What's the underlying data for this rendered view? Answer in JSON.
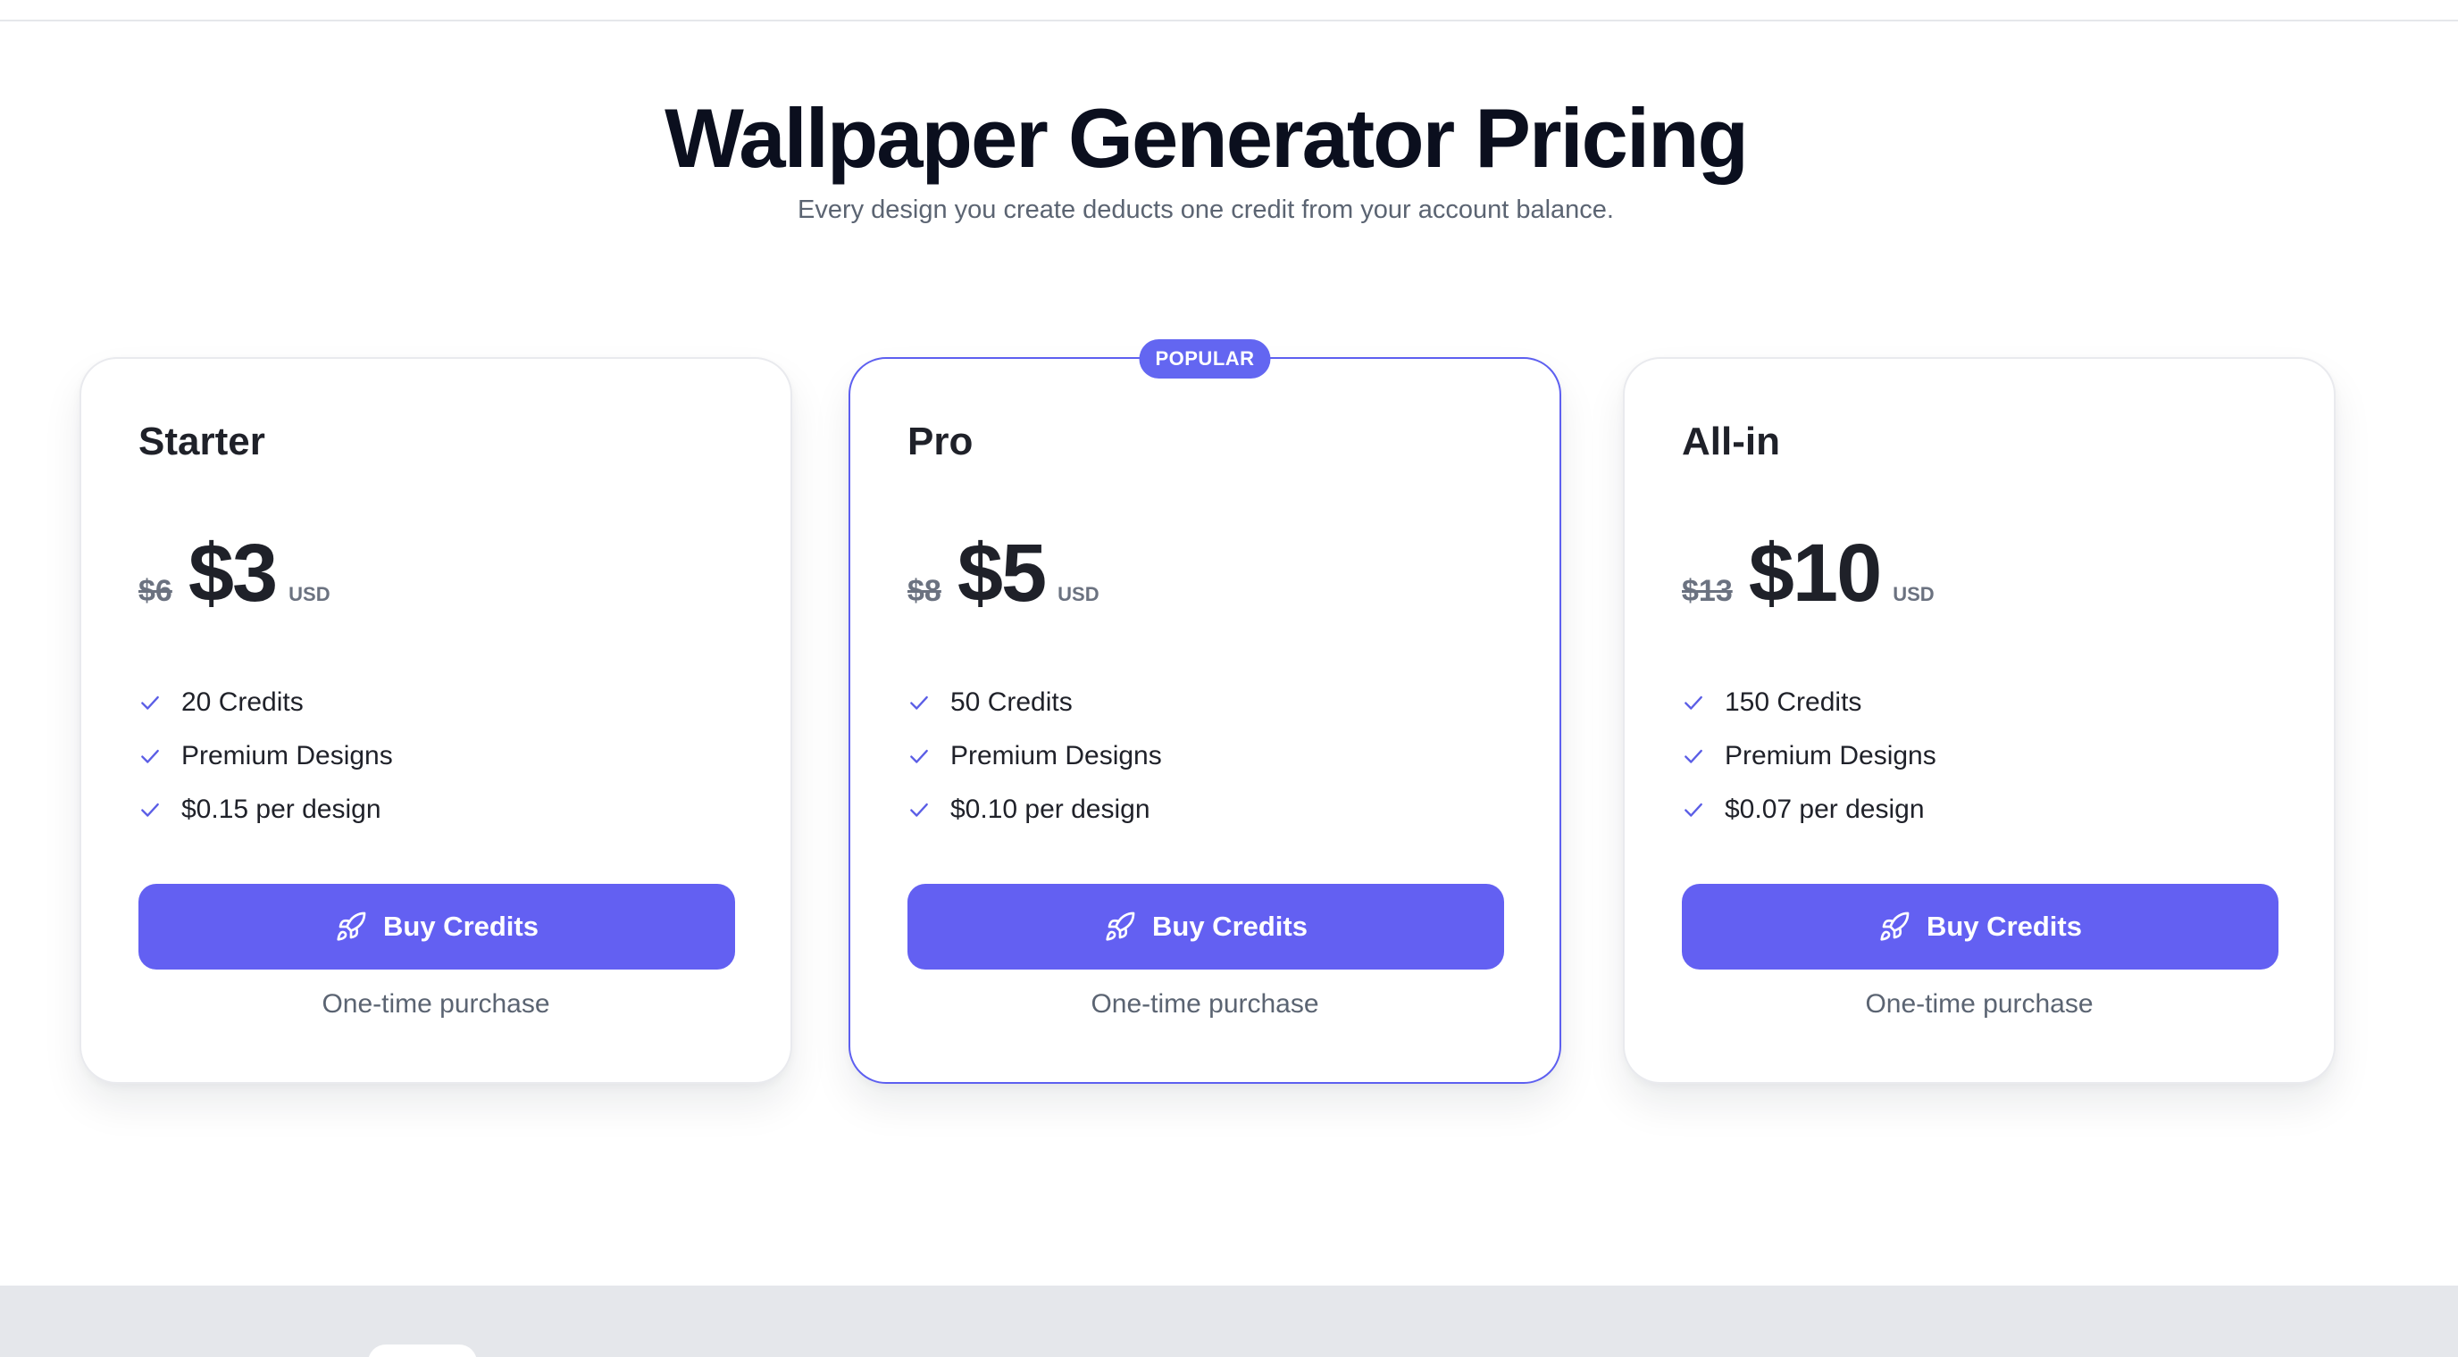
{
  "header": {
    "title": "Wallpaper Generator Pricing",
    "subtitle": "Every design you create deducts one credit from your account balance."
  },
  "plans": [
    {
      "name": "Starter",
      "old_price": "$6",
      "price": "$3",
      "currency": "USD",
      "features": [
        "20 Credits",
        "Premium Designs",
        "$0.15 per design"
      ],
      "button_label": "Buy Credits",
      "note": "One-time purchase"
    },
    {
      "name": "Pro",
      "badge": "POPULAR",
      "old_price": "$8",
      "price": "$5",
      "currency": "USD",
      "features": [
        "50 Credits",
        "Premium Designs",
        "$0.10 per design"
      ],
      "button_label": "Buy Credits",
      "note": "One-time purchase"
    },
    {
      "name": "All-in",
      "old_price": "$13",
      "price": "$10",
      "currency": "USD",
      "features": [
        "150 Credits",
        "Premium Designs",
        "$0.07 per design"
      ],
      "button_label": "Buy Credits",
      "note": "One-time purchase"
    }
  ],
  "icons": {
    "check": "check-icon",
    "button": "rocket-icon"
  },
  "colors": {
    "accent": "#6366f1",
    "button": "#6360f2",
    "title": "#0b0f1e",
    "muted": "#5b6472",
    "footer": "#e5e7eb"
  }
}
